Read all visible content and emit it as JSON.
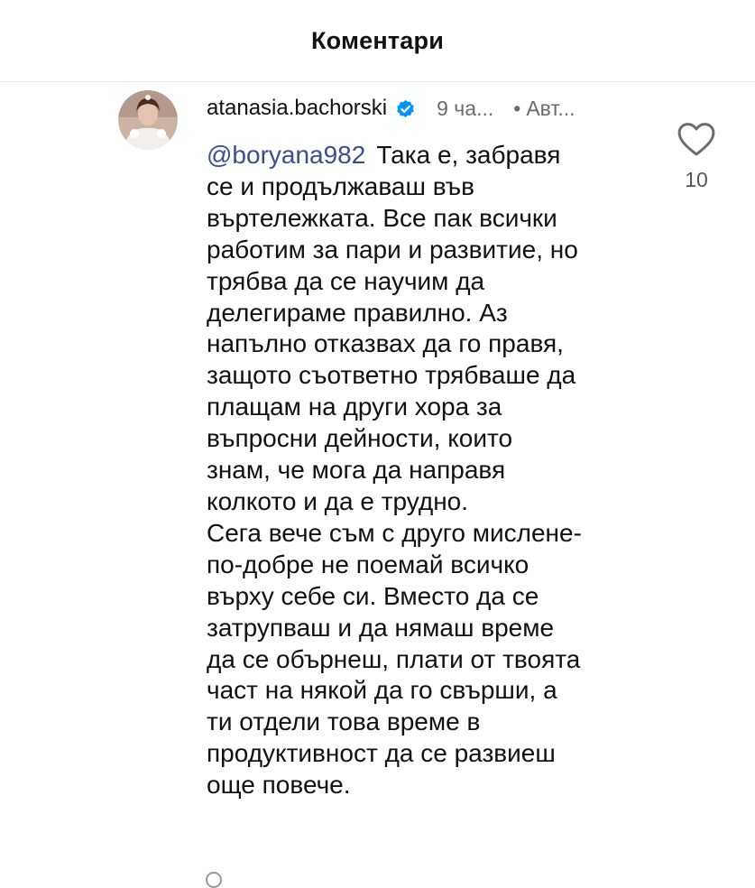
{
  "header": {
    "title": "Коментари"
  },
  "comment": {
    "username": "atanasia.bachorski",
    "verified": true,
    "time": "9 ча...",
    "author_label": "Авт...",
    "mention": "@boryana982",
    "text_lines": [
      "Така е, забравя",
      "се и продължаваш във",
      "въртележката. Все пак всички",
      "работим за пари и развитие, но",
      "трябва да се научим да",
      "делегираме правилно. Аз",
      "напълно отказвах да го правя,",
      "защото съответно трябваше да",
      "плащам на други хора за",
      "въпросни дейности, които",
      "знам, че мога да направя",
      "колкото и да е трудно.",
      "Сега вече съм с друго мислене-",
      "по-добре не поемай всичко",
      "върху себе си. Вместо да се",
      "затрупваш и да нямаш време",
      "да се обърнеш, плати от твоята",
      "част на някой да го свърши, а",
      "ти отдели това време в",
      "продуктивност да се развиеш",
      "още повече."
    ],
    "like_count": "10"
  },
  "colors": {
    "verified_badge": "#0095f6",
    "mention": "#3b4f8a",
    "meta_text": "#6b6b6b"
  },
  "icons": {
    "like": "heart-outline-icon",
    "verified": "verified-badge-icon"
  }
}
